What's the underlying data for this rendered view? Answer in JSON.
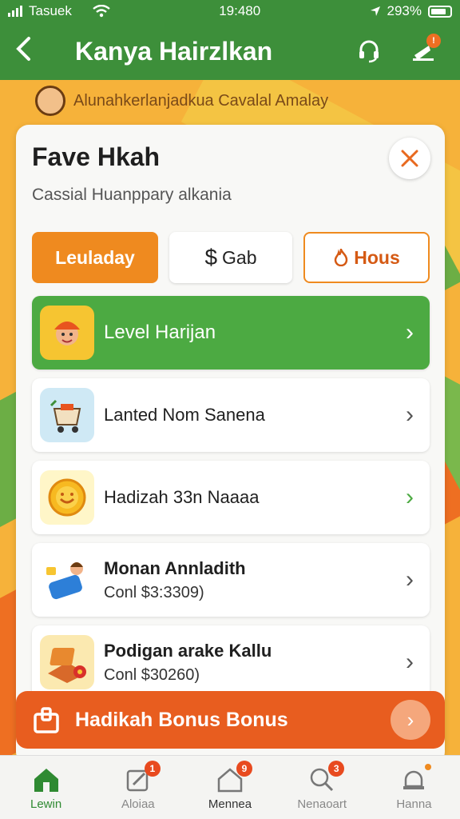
{
  "status_bar": {
    "carrier": "Tasuek",
    "time": "19:480",
    "battery": "293%"
  },
  "app_bar": {
    "title": "Kanya Hairzlkan",
    "notification_badge": "!"
  },
  "banner": {
    "text": "Alunahkerlanjadkua Cavalal Amalay"
  },
  "card": {
    "title": "Fave Hkah",
    "subtitle": "Cassial Huanppary alkania",
    "chips": [
      {
        "label": "Leuladay"
      },
      {
        "icon": "$",
        "label": "Gab"
      },
      {
        "label": "Hous"
      }
    ],
    "items": [
      {
        "name": "Level Harijan",
        "sub": ""
      },
      {
        "name": "Lanted Nom Sanena",
        "sub": ""
      },
      {
        "name": "Hadizah 33n Naaaa",
        "sub": ""
      },
      {
        "name": "Monan Annladith",
        "sub": "Conl  $3:3309)"
      },
      {
        "name": "Podigan arake Kallu",
        "sub": "Conl  $30260)"
      }
    ]
  },
  "bonus_button": {
    "label": "Hadikah Bonus Bonus"
  },
  "tabs": [
    {
      "label": "Lewin",
      "badge": ""
    },
    {
      "label": "Aloiaa",
      "badge": "1"
    },
    {
      "label": "Mennea",
      "badge": "9"
    },
    {
      "label": "Nenaoart",
      "badge": "3"
    },
    {
      "label": "Hanna",
      "badge": ""
    }
  ],
  "colors": {
    "primary_green": "#3d8f3a",
    "accent_orange": "#ef8a1f",
    "bonus_orange": "#e85d1f"
  }
}
